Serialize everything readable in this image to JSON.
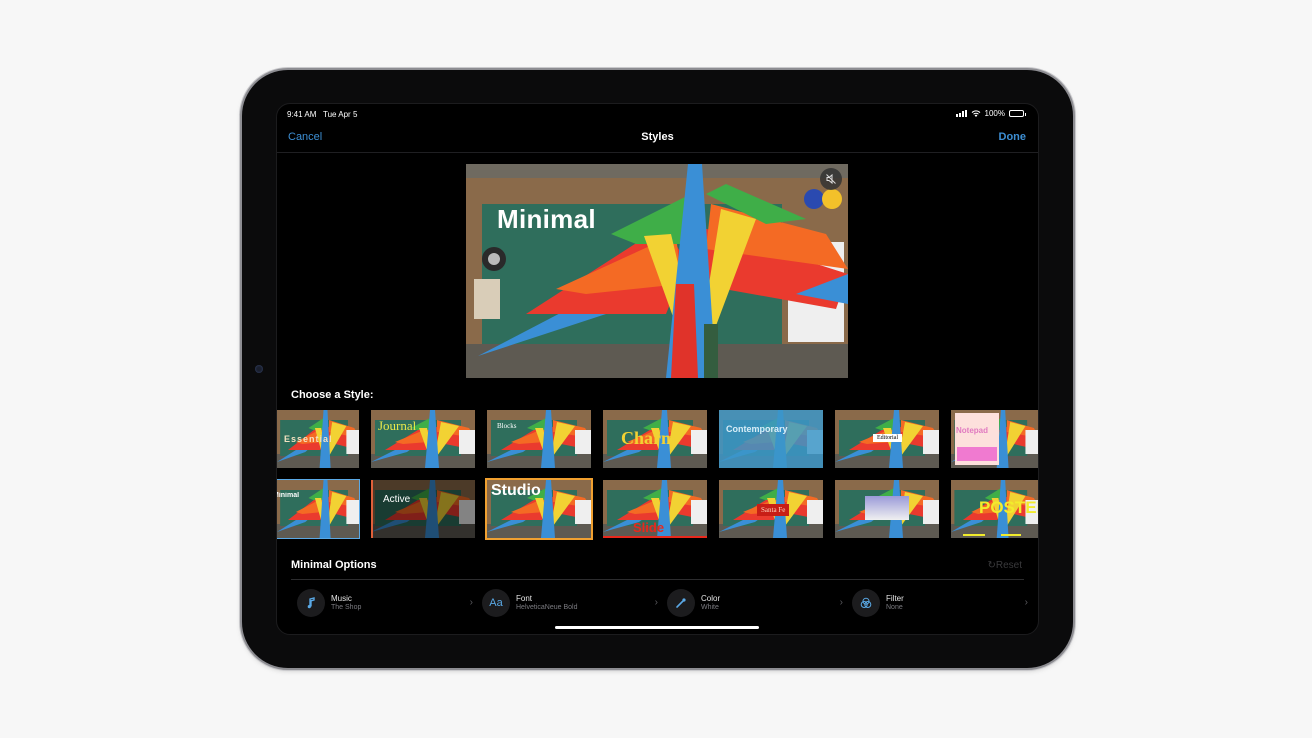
{
  "status_bar": {
    "time": "9:41 AM",
    "date": "Tue Apr 5",
    "battery": "100%",
    "battery_level": 1.0
  },
  "nav": {
    "cancel_label": "Cancel",
    "title": "Styles",
    "done_label": "Done"
  },
  "preview": {
    "style_title": "Minimal",
    "mute_icon": "speaker-slash-icon"
  },
  "styles": {
    "section_label": "Choose a Style:",
    "selected": "Minimal",
    "items": [
      {
        "label": "Essential",
        "row": 1
      },
      {
        "label": "Journal",
        "row": 1
      },
      {
        "label": "Blocks",
        "row": 1
      },
      {
        "label": "Charm",
        "row": 1
      },
      {
        "label": "Contemporary",
        "row": 1
      },
      {
        "label": "Editorial",
        "row": 1
      },
      {
        "label": "Notepad",
        "row": 1
      },
      {
        "label": "Minimal",
        "row": 2
      },
      {
        "label": "Active",
        "row": 2
      },
      {
        "label": "Studio",
        "row": 2
      },
      {
        "label": "Slide",
        "row": 2
      },
      {
        "label": "Santa Fe",
        "row": 2
      },
      {
        "label": "",
        "row": 2
      },
      {
        "label": "POSTER",
        "row": 2
      }
    ]
  },
  "options": {
    "title": "Minimal Options",
    "reset_label": "Reset",
    "items": [
      {
        "label": "Music",
        "value": "The Shop",
        "icon": "music-note-icon"
      },
      {
        "label": "Font",
        "value": "HelveticaNeue Bold",
        "icon": "font-icon",
        "icon_text": "Aa"
      },
      {
        "label": "Color",
        "value": "White",
        "icon": "eyedropper-icon"
      },
      {
        "label": "Filter",
        "value": "None",
        "icon": "filter-icon"
      }
    ]
  },
  "colors": {
    "accent": "#3d8fd4",
    "selected_border": "#5aa9e6",
    "studio_border": "#f0a030"
  }
}
